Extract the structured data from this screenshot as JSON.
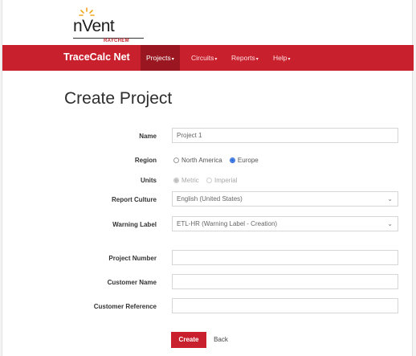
{
  "brand": {
    "logo_text": "nVent",
    "logo_sub": "RAYCHEM"
  },
  "navbar": {
    "app_name": "TraceCalc Net",
    "items": [
      {
        "label": "Projects"
      },
      {
        "label": "Circuits"
      },
      {
        "label": "Reports"
      },
      {
        "label": "Help"
      }
    ]
  },
  "page_title": "Create Project",
  "form": {
    "name_label": "Name",
    "name_value": "Project 1",
    "region_label": "Region",
    "region_options": [
      "North America",
      "Europe"
    ],
    "region_selected": "Europe",
    "units_label": "Units",
    "units_options": [
      "Metric",
      "Imperial"
    ],
    "units_selected": "Metric",
    "report_culture_label": "Report Culture",
    "report_culture_value": "English (United States)",
    "warning_label_label": "Warning Label",
    "warning_label_value": "ETL-HR (Warning Label - Creation)",
    "project_number_label": "Project Number",
    "project_number_value": "",
    "customer_name_label": "Customer Name",
    "customer_name_value": "",
    "customer_reference_label": "Customer Reference",
    "customer_reference_value": ""
  },
  "actions": {
    "create_label": "Create",
    "back_label": "Back"
  },
  "colors": {
    "brand_red": "#c8202d",
    "nav_active": "#9a1620",
    "radio_blue": "#2d6cdf"
  },
  "icons": {
    "logo": "nvent-rays-icon",
    "dropdown": "chevron-down-icon"
  }
}
